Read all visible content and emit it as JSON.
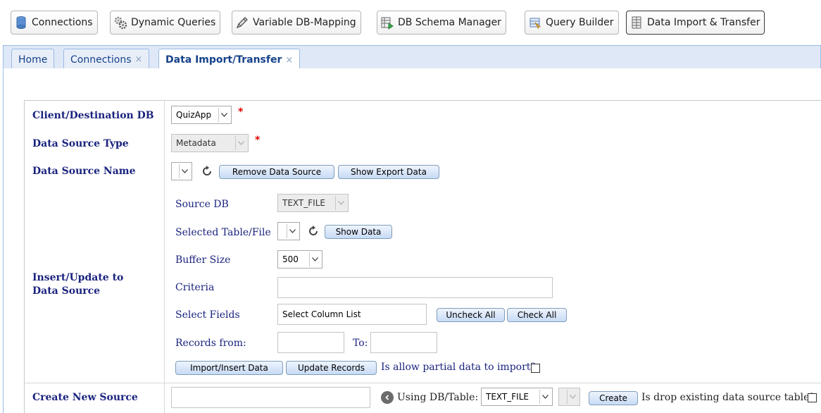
{
  "toolbar": {
    "items": [
      {
        "label": "Connections",
        "icon": "database-icon"
      },
      {
        "label": "Dynamic Queries",
        "icon": "gears-icon"
      },
      {
        "label": "Variable DB-Mapping",
        "icon": "pen-icon"
      },
      {
        "label": "DB Schema Manager",
        "icon": "schema-icon"
      },
      {
        "label": "Query Builder",
        "icon": "query-icon"
      },
      {
        "label": "Data Import & Transfer",
        "icon": "transfer-icon",
        "active": true
      }
    ]
  },
  "tabs": [
    {
      "label": "Home",
      "closable": false
    },
    {
      "label": "Connections",
      "closable": true,
      "close": "×"
    },
    {
      "label": "Data Import/Transfer",
      "closable": true,
      "close": "×",
      "active": true
    }
  ],
  "form": {
    "client_db": {
      "label": "Client/Destination DB",
      "value": "QuizApp",
      "required": "*"
    },
    "source_type": {
      "label": "Data Source Type",
      "value": "Metadata",
      "required": "*"
    },
    "source_name": {
      "label": "Data Source Name",
      "value": "",
      "remove_label": "Remove Data Source",
      "export_label": "Show Export Data"
    },
    "insert_update": {
      "label_line1": "Insert/Update to",
      "label_line2": "Data Source",
      "source_db": {
        "label": "Source DB",
        "value": "TEXT_FILE"
      },
      "selected_table": {
        "label": "Selected Table/File",
        "value": "",
        "show_data_label": "Show Data"
      },
      "buffer_size": {
        "label": "Buffer Size",
        "value": "500"
      },
      "criteria": {
        "label": "Criteria",
        "value": ""
      },
      "select_fields": {
        "label": "Select Fields",
        "value": "Select Column List",
        "uncheck_label": "Uncheck All",
        "check_label": "Check All"
      },
      "records": {
        "from_label": "Records from:",
        "to_label": "To:",
        "from_value": "",
        "to_value": ""
      },
      "import_label": "Import/Insert Data",
      "update_label": "Update Records",
      "partial_label": "Is allow partial data to import?"
    },
    "create_source": {
      "label": "Create New Source",
      "value": "",
      "using_label": "Using DB/Table:",
      "db_value": "TEXT_FILE",
      "table_value": "",
      "create_label": "Create",
      "drop_label": "Is drop existing data source table?"
    }
  },
  "colors": {
    "tab_bg": "#dfe8f6",
    "label_navy": "#1a237e",
    "required_red": "#e00000",
    "button_blue": "#c7dbf5"
  }
}
